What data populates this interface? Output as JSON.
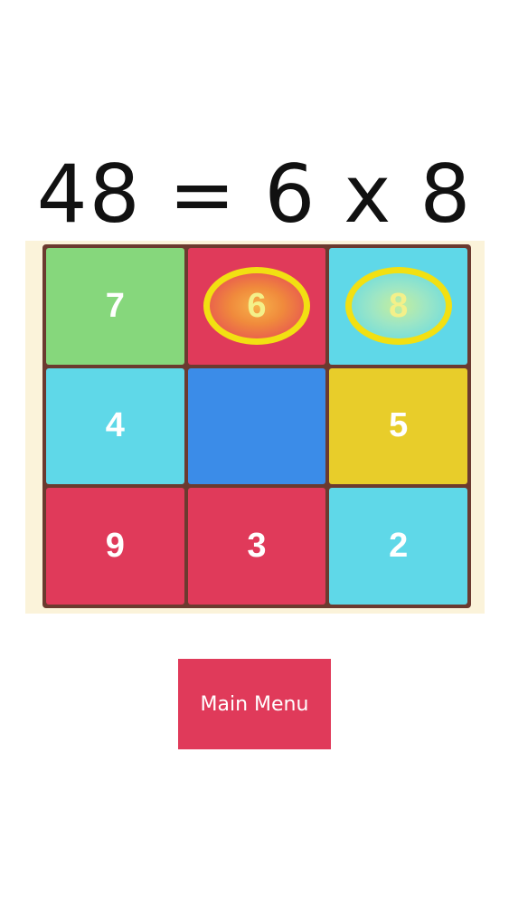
{
  "equation": {
    "text": "48 = 6 x 8"
  },
  "colors": {
    "green": "#86d77c",
    "red": "#e03a5a",
    "cyan": "#5fd8e8",
    "blue": "#3b8ce8",
    "yellow": "#e8cd2a",
    "board_frame": "#6b3a2f",
    "board_background": "#fbf3da",
    "selection_ring": "#f2e012",
    "button": "#e03a5a"
  },
  "grid": {
    "rows": 3,
    "cols": 3,
    "tiles": [
      {
        "label": "7",
        "color": "green",
        "selected": false,
        "empty": false
      },
      {
        "label": "6",
        "color": "red",
        "selected": true,
        "empty": false
      },
      {
        "label": "8",
        "color": "cyan",
        "selected": true,
        "empty": false
      },
      {
        "label": "4",
        "color": "cyan",
        "selected": false,
        "empty": false
      },
      {
        "label": "",
        "color": "blue",
        "selected": false,
        "empty": true
      },
      {
        "label": "5",
        "color": "yellow",
        "selected": false,
        "empty": false
      },
      {
        "label": "9",
        "color": "red",
        "selected": false,
        "empty": false
      },
      {
        "label": "3",
        "color": "red",
        "selected": false,
        "empty": false
      },
      {
        "label": "2",
        "color": "cyan",
        "selected": false,
        "empty": false
      }
    ]
  },
  "main_menu_button": {
    "label": "Main Menu"
  }
}
